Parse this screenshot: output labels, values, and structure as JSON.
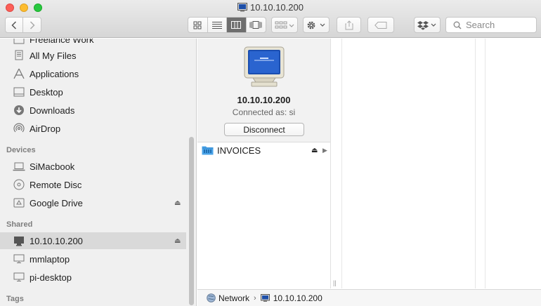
{
  "window": {
    "title": "10.10.10.200"
  },
  "toolbar": {
    "back_icon": "chevron-left-icon",
    "forward_icon": "chevron-right-icon",
    "view_modes": [
      "icon-view-icon",
      "list-view-icon",
      "column-view-icon",
      "cover-flow-icon"
    ],
    "active_view": 2,
    "arrange_icon": "arrange-icon",
    "action_icon": "gear-icon",
    "share_icon": "share-icon",
    "tag_icon": "tag-icon",
    "dropbox_icon": "dropbox-icon",
    "search_placeholder": "Search"
  },
  "sidebar": {
    "partial_top": "Freelance Work",
    "favorites": [
      {
        "label": "All My Files",
        "icon": "all-files-icon"
      },
      {
        "label": "Applications",
        "icon": "applications-icon"
      },
      {
        "label": "Desktop",
        "icon": "desktop-icon"
      },
      {
        "label": "Downloads",
        "icon": "downloads-icon"
      },
      {
        "label": "AirDrop",
        "icon": "airdrop-icon"
      }
    ],
    "devices_header": "Devices",
    "devices": [
      {
        "label": "SiMacbook",
        "icon": "laptop-icon"
      },
      {
        "label": "Remote Disc",
        "icon": "disc-icon"
      },
      {
        "label": "Google Drive",
        "icon": "drive-icon",
        "eject": true
      }
    ],
    "shared_header": "Shared",
    "shared": [
      {
        "label": "10.10.10.200",
        "icon": "monitor-icon",
        "eject": true,
        "selected": true
      },
      {
        "label": "mmlaptop",
        "icon": "display-icon"
      },
      {
        "label": "pi-desktop",
        "icon": "display-icon"
      }
    ],
    "tags_header": "Tags"
  },
  "server": {
    "name": "10.10.10.200",
    "connected_as": "Connected as: si",
    "disconnect_label": "Disconnect"
  },
  "listing": [
    {
      "label": "INVOICES",
      "icon": "shared-folder-icon"
    }
  ],
  "pathbar": {
    "items": [
      {
        "label": "Network",
        "icon": "network-globe-icon"
      },
      {
        "label": "10.10.10.200",
        "icon": "monitor-icon"
      }
    ]
  },
  "colors": {
    "selection": "#d9d9d9",
    "sidebar_bg": "#f0f0f0",
    "folder_blue": "#4aa3e8"
  }
}
